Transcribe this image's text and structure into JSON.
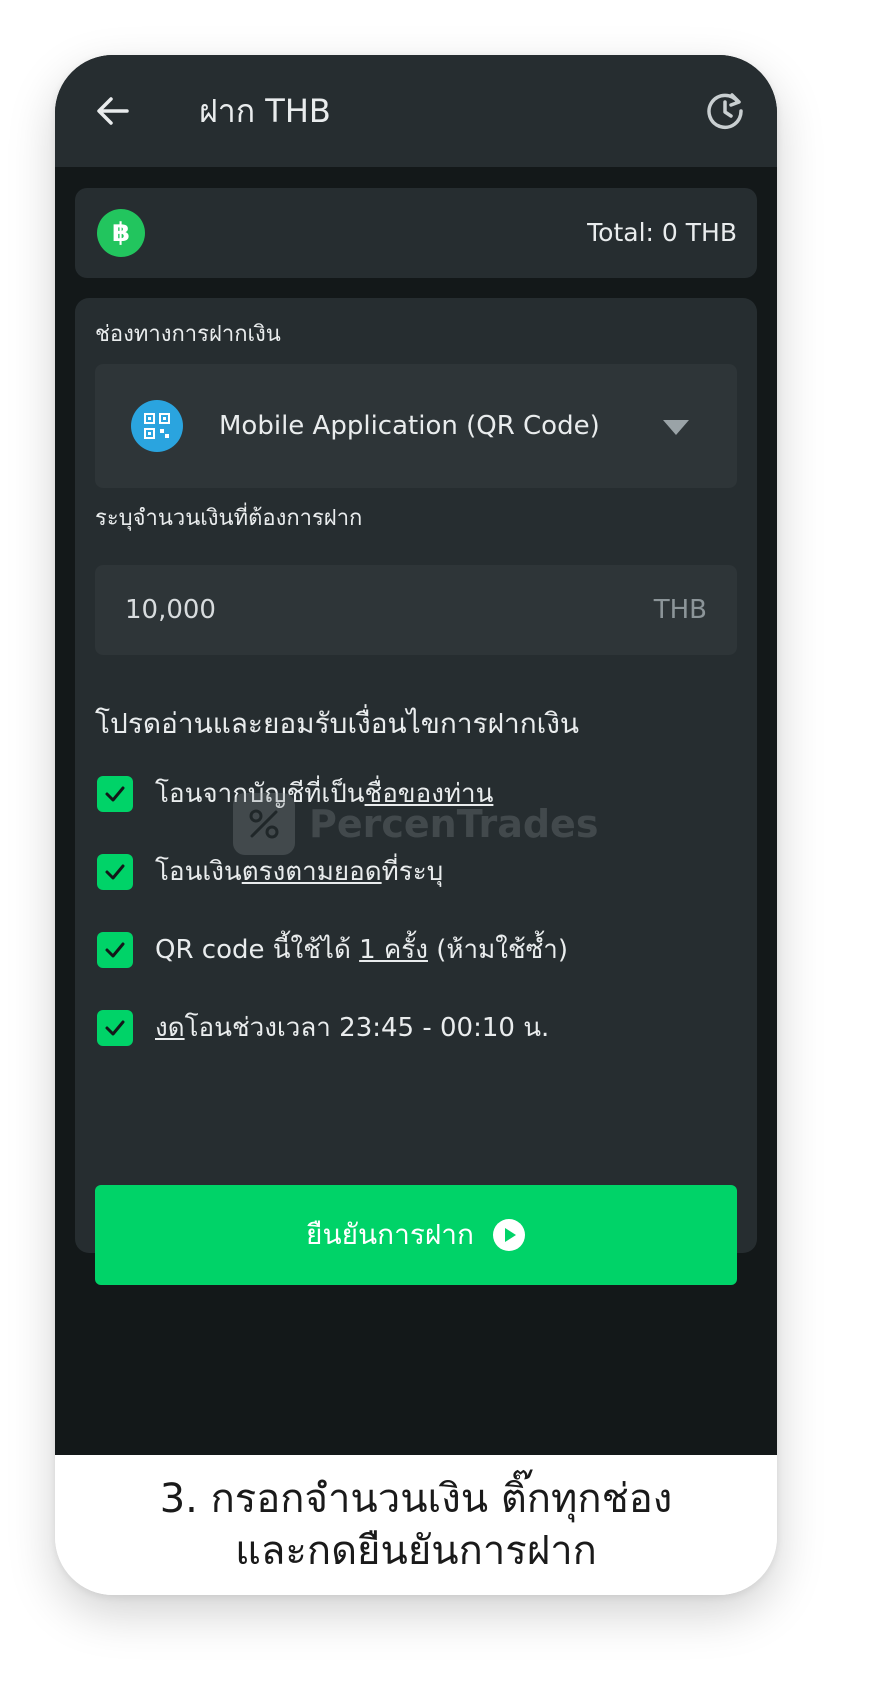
{
  "header": {
    "title": "ฝาก THB",
    "back_icon": "arrow-left-icon",
    "history_icon": "history-refresh-icon"
  },
  "balance": {
    "currency_icon": "baht-coin-icon",
    "total": "Total: 0 THB"
  },
  "form": {
    "channel_label": "ช่องทางการฝากเงิน",
    "channel_value": "Mobile Application (QR Code)",
    "channel_icon": "qr-code-icon",
    "amount_label": "ระบุจำนวนเงินที่ต้องการฝาก",
    "amount_value": "10,000",
    "amount_unit": "THB",
    "terms_title": "โปรดอ่านและยอมรับเงื่อนไขการฝากเงิน",
    "terms": [
      {
        "checked": true,
        "text_a": "โอนจากบัญชีที่เป็น",
        "text_u": "ชื่อของท่าน",
        "text_b": ""
      },
      {
        "checked": true,
        "text_a": "โอนเงิน",
        "text_u": "ตรงตามยอด",
        "text_b": "ที่ระบุ"
      },
      {
        "checked": true,
        "text_a": "QR code นี้ใช้ได้ ",
        "text_u": "1 ครั้ง",
        "text_b": " (ห้ามใช้ซ้ำ)"
      },
      {
        "checked": true,
        "text_a": "",
        "text_u": "งด",
        "text_b": "โอนช่วงเวลา 23:45 - 00:10 น."
      }
    ],
    "confirm_label": "ยืนยันการฝาก",
    "confirm_icon": "play-circle-icon"
  },
  "watermark": {
    "text": "PercenTrades"
  },
  "caption": {
    "line1": "3. กรอกจำนวนเงิน ติ๊กทุกช่อง",
    "line2": "และกดยืนยันการฝาก"
  },
  "colors": {
    "accent_green": "#00d368",
    "header_bg": "#262d30",
    "screen_bg": "#131819",
    "qr_blue": "#2aa4df"
  }
}
